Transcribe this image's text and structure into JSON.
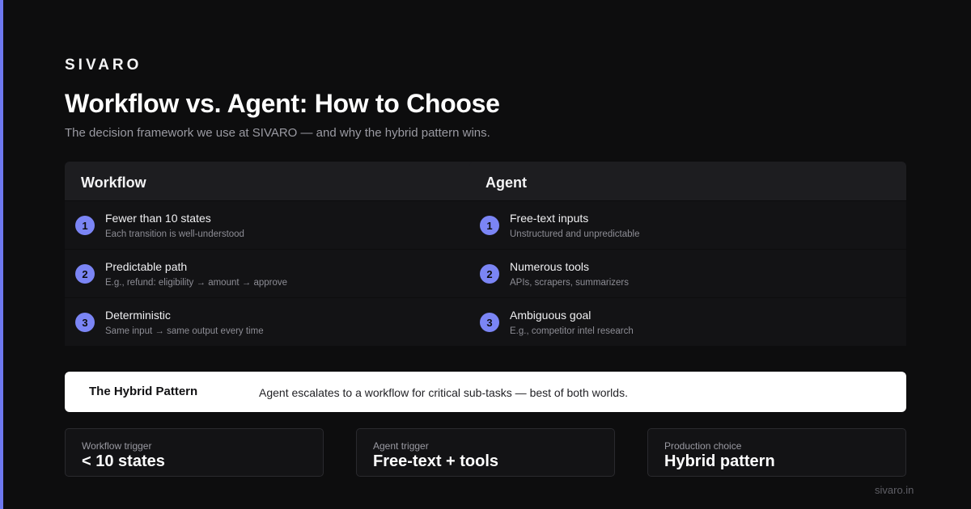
{
  "brand": "SIVARO",
  "title": "Workflow vs. Agent: How to Choose",
  "subtitle": "The decision framework we use at SIVARO — and why the hybrid pattern wins.",
  "columns": [
    {
      "heading": "Workflow",
      "items": [
        {
          "num": "1",
          "title": "Fewer than 10 states",
          "sub": "Each transition is well-understood"
        },
        {
          "num": "2",
          "title": "Predictable path",
          "sub": "E.g., refund: eligibility → amount → approve"
        },
        {
          "num": "3",
          "title": "Deterministic",
          "sub": "Same input → same output every time"
        }
      ]
    },
    {
      "heading": "Agent",
      "items": [
        {
          "num": "1",
          "title": "Free-text inputs",
          "sub": "Unstructured and unpredictable"
        },
        {
          "num": "2",
          "title": "Numerous tools",
          "sub": "APIs, scrapers, summarizers"
        },
        {
          "num": "3",
          "title": "Ambiguous goal",
          "sub": "E.g., competitor intel research"
        }
      ]
    }
  ],
  "hybrid": {
    "label": "The Hybrid Pattern",
    "text": "Agent escalates to a workflow for critical sub-tasks — best of both worlds."
  },
  "stats": [
    {
      "label": "Workflow trigger",
      "value": "< 10 states"
    },
    {
      "label": "Agent trigger",
      "value": "Free-text + tools"
    },
    {
      "label": "Production choice",
      "value": "Hybrid pattern"
    }
  ],
  "footer": "sivaro.in",
  "colors": {
    "background": "#0d0d0e",
    "accent": "#7b85f5",
    "panel": "#131315",
    "panel_header": "#1d1d20"
  }
}
